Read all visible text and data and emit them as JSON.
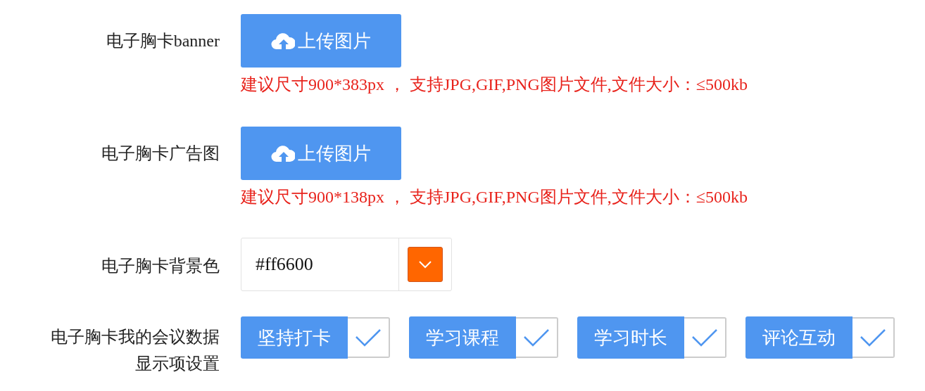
{
  "fields": [
    {
      "kind": "upload",
      "label": "电子胸卡banner",
      "button": "上传图片",
      "hint": "建议尺寸900*383px ， 支持JPG,GIF,PNG图片文件,文件大小：≤500kb"
    },
    {
      "kind": "upload",
      "label": "电子胸卡广告图",
      "button": "上传图片",
      "hint": "建议尺寸900*138px ， 支持JPG,GIF,PNG图片文件,文件大小：≤500kb"
    },
    {
      "kind": "color",
      "label": "电子胸卡背景色",
      "value": "#ff6600"
    },
    {
      "kind": "checks",
      "label": "电子胸卡我的会议数据显示项设置",
      "options": [
        {
          "label": "坚持打卡",
          "checked": true
        },
        {
          "label": "学习课程",
          "checked": true
        },
        {
          "label": "学习时长",
          "checked": true
        },
        {
          "label": "评论互动",
          "checked": true
        }
      ]
    }
  ]
}
